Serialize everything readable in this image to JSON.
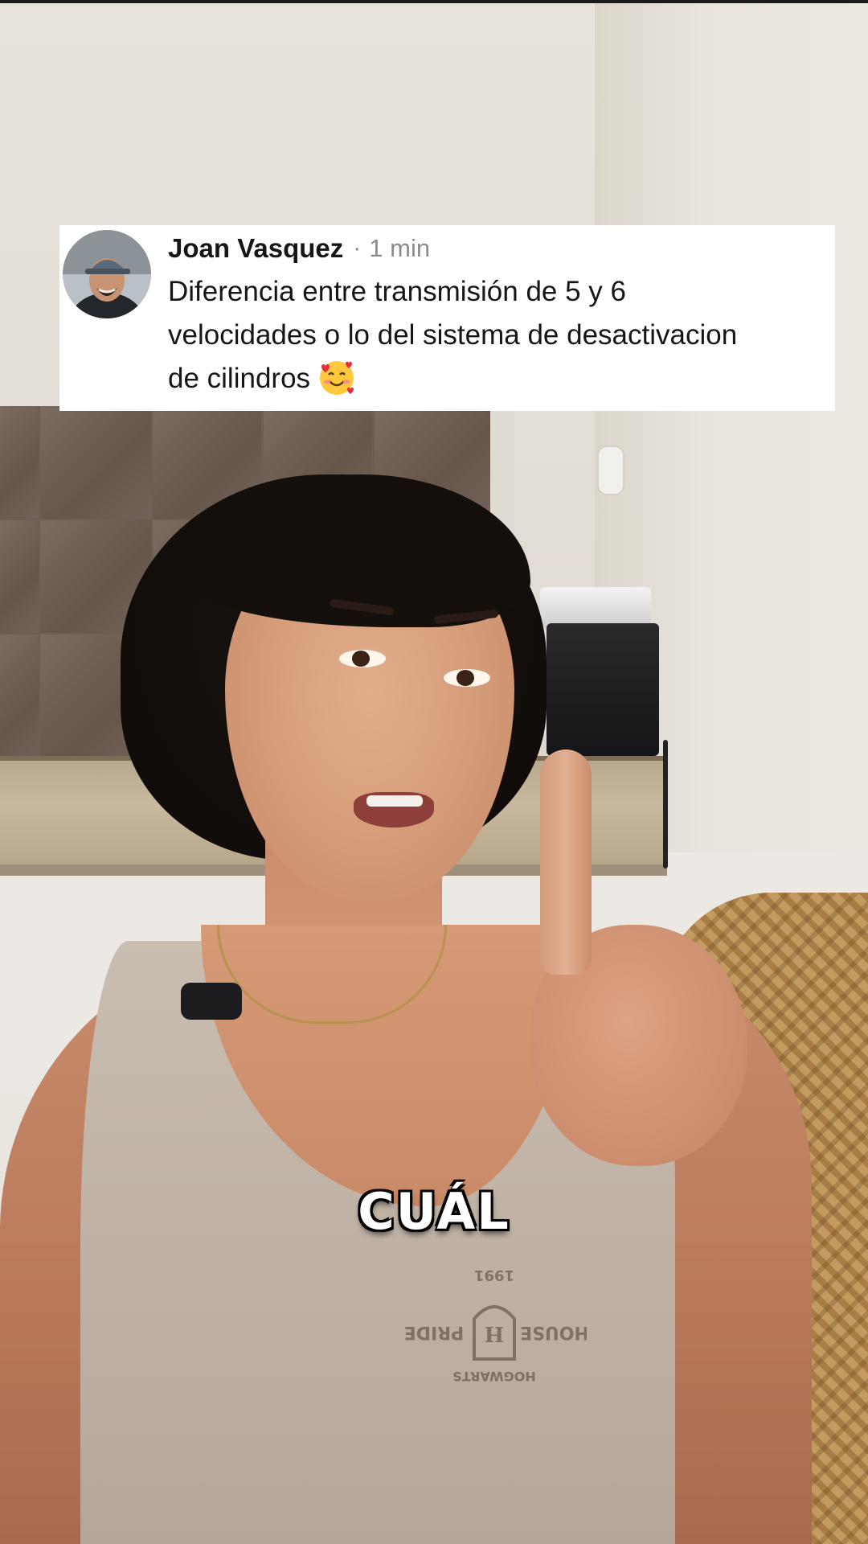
{
  "comment": {
    "author": "Joan Vasquez",
    "separator": "·",
    "time": "1 min",
    "lines": [
      "Diferencia entre transmisión de 5 y 6",
      "velocidades o lo del sistema de desactivacion",
      "de cilindros"
    ],
    "emoji": "smiling-face-with-hearts"
  },
  "caption": "CUÁL",
  "shirt_print": {
    "line1": "HOGWARTS",
    "line2": "HOUSE",
    "line3": "PRIDE",
    "year": "1991"
  },
  "colors": {
    "card_background": "#ffffff",
    "author_text": "#161616",
    "timestamp_text": "#8c8c8c",
    "caption_text": "#ffffff",
    "caption_outline": "#000000"
  }
}
